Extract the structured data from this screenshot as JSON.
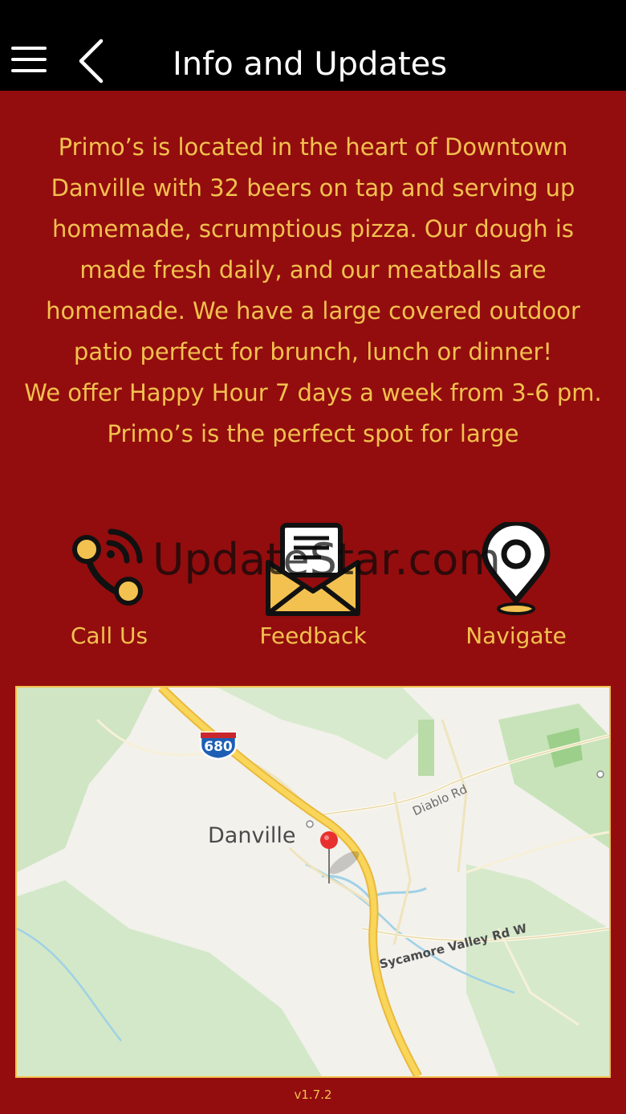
{
  "header": {
    "title": "Info and Updates",
    "menu_icon": "hamburger-icon",
    "back_icon": "chevron-left-icon"
  },
  "description": {
    "paragraph_1": "Primo’s is located in the heart of Downtown Danville with 32 beers on tap and serving up homemade, scrumptious pizza. Our dough is made fresh daily, and our meatballs are homemade. We have a large covered outdoor patio perfect for brunch, lunch or dinner!",
    "paragraph_2": "We offer Happy Hour 7 days a week from 3-6 pm. Primo’s is the perfect spot for large"
  },
  "actions": [
    {
      "label": "Call Us",
      "icon": "phone-call-icon"
    },
    {
      "label": "Feedback",
      "icon": "envelope-icon"
    },
    {
      "label": "Navigate",
      "icon": "map-pin-icon"
    }
  ],
  "watermark": "UpdateStar.com",
  "map": {
    "city_label": "Danville",
    "highway_shield": "680",
    "road_labels": [
      "Diablo Rd",
      "Sycamore Valley Rd W"
    ]
  },
  "footer": {
    "version": "v1.7.2"
  },
  "colors": {
    "background": "#930d0e",
    "header": "#000000",
    "accent": "#f3c14f",
    "pin": "#e8312f"
  }
}
